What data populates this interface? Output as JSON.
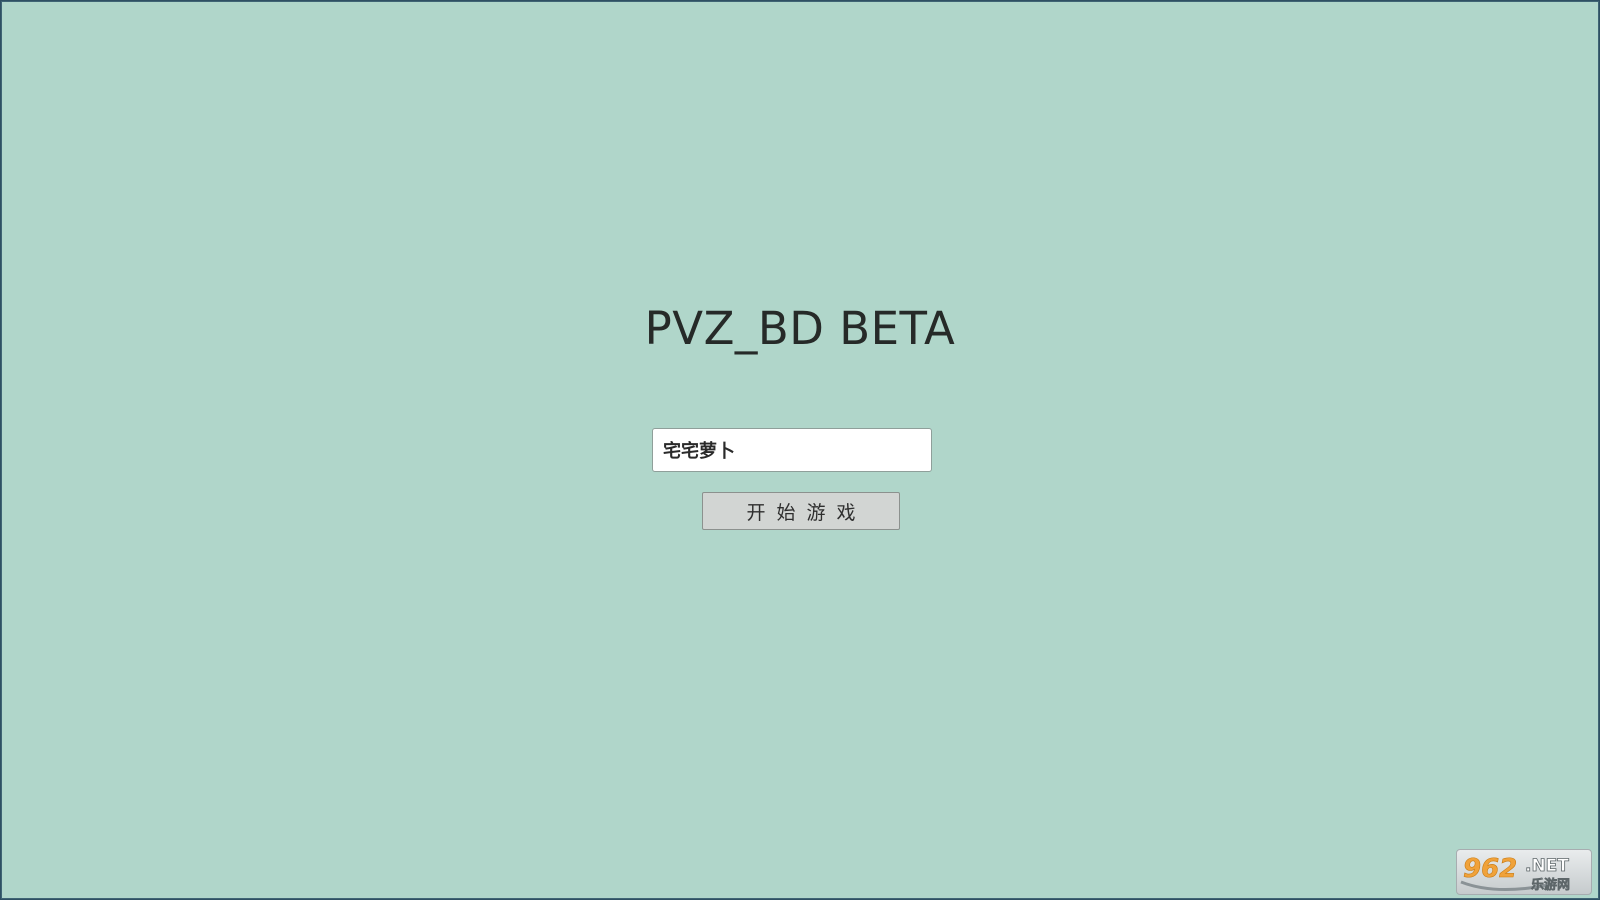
{
  "game": {
    "title": "PVZ_BD BETA"
  },
  "login": {
    "player_name": "宅宅萝卜",
    "start_label": "开始游戏"
  },
  "watermark": {
    "brand_number": "962",
    "brand_suffix": ".NET",
    "brand_cn": "乐游网"
  },
  "colors": {
    "background": "#b0d6ca",
    "title_text": "#262a28",
    "button_bg": "#d2d5d3"
  }
}
